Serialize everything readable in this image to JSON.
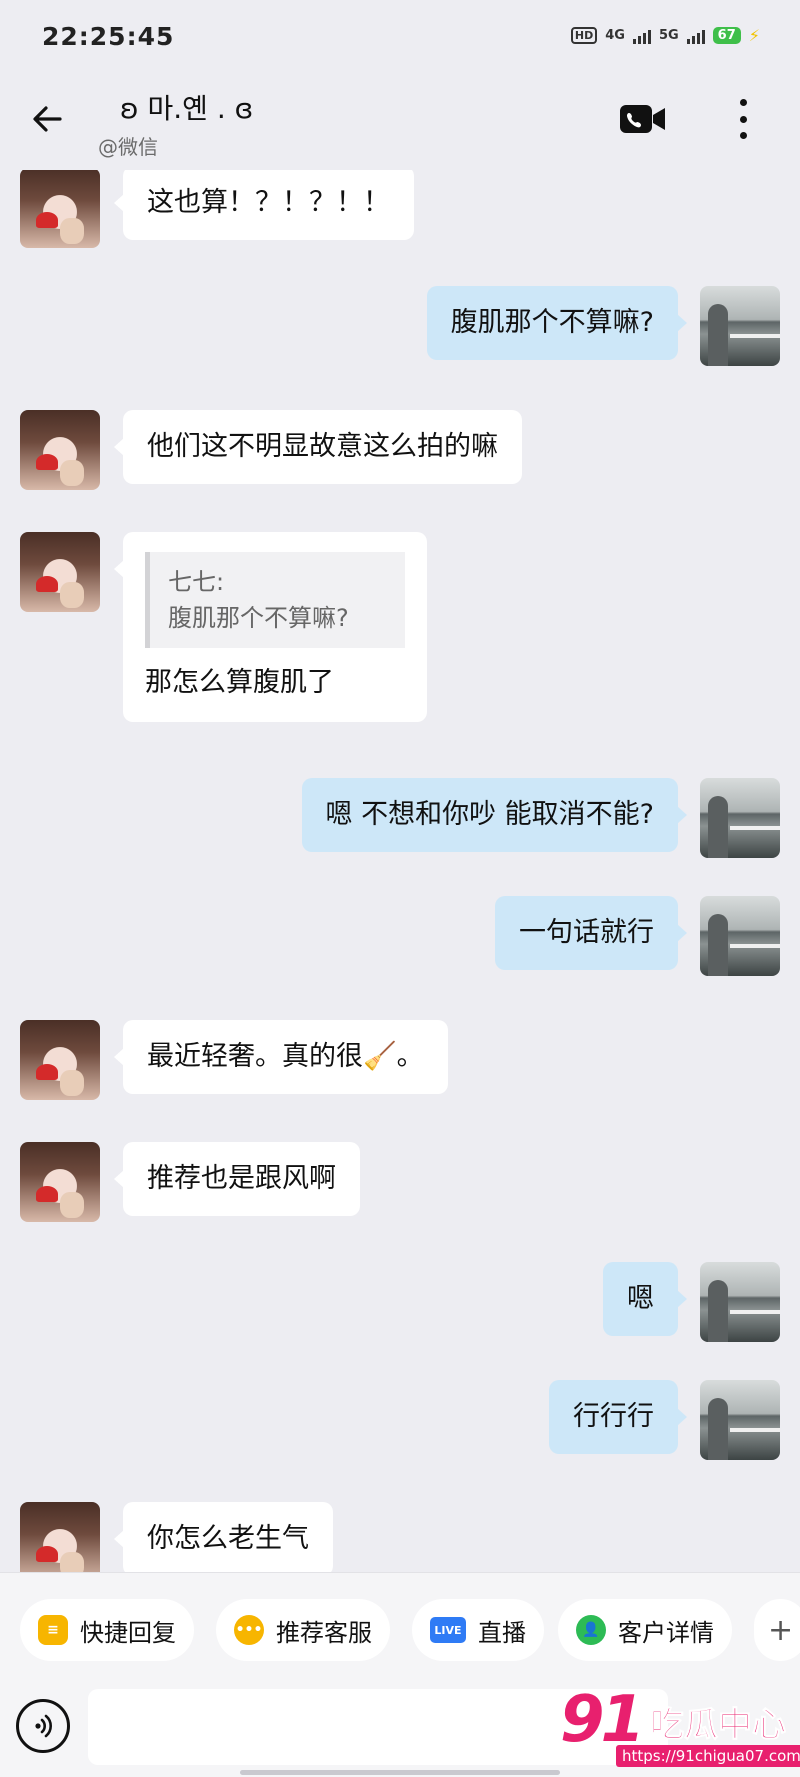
{
  "status_bar": {
    "time": "22:25:45",
    "hd_label": "HD",
    "net_4g": "4G",
    "net_5g": "5G",
    "battery": "67"
  },
  "header": {
    "title": "ʚ 마.옌 . ɞ",
    "subtitle": "@微信",
    "icons": [
      "back-arrow-icon",
      "video-call-icon",
      "more-options-icon"
    ]
  },
  "messages": [
    {
      "side": "left",
      "text": "这也算！？！？！！"
    },
    {
      "side": "right",
      "text": "腹肌那个不算嘛?"
    },
    {
      "side": "left",
      "text": "他们这不明显故意这么拍的嘛"
    },
    {
      "side": "left",
      "type": "quote",
      "quote_name": "七七:",
      "quote_text": "腹肌那个不算嘛?",
      "text": "那怎么算腹肌了"
    },
    {
      "side": "right",
      "text": "嗯 不想和你吵 能取消不能?"
    },
    {
      "side": "right",
      "text": "一句话就行"
    },
    {
      "side": "left",
      "text": "最近轻奢。真的很🧹。"
    },
    {
      "side": "left",
      "text": "推荐也是跟风啊"
    },
    {
      "side": "right",
      "text": "嗯"
    },
    {
      "side": "right",
      "text": "行行行"
    },
    {
      "side": "left",
      "text": "你怎么老生气"
    }
  ],
  "quick_actions": [
    {
      "label": "快捷回复",
      "icon": "quick-reply-icon",
      "color": "#f7b500"
    },
    {
      "label": "推荐客服",
      "icon": "recommend-service-icon",
      "color": "#f7b500"
    },
    {
      "label": "直播",
      "icon": "live-icon",
      "icon_text": "LIVE",
      "color": "#2f7bf5"
    },
    {
      "label": "客户详情",
      "icon": "customer-detail-icon",
      "color": "#2dbb55"
    },
    {
      "label": "+",
      "icon": "plus-icon"
    }
  ],
  "input": {
    "placeholder": ""
  },
  "watermark": {
    "number": "91",
    "title": "吃瓜中心",
    "url": "https://91chigua07.com"
  }
}
